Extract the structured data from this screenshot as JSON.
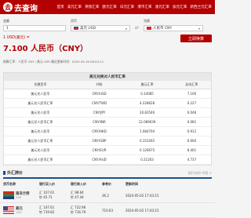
{
  "header": {
    "logo": "去查询",
    "logo_mark": "去",
    "nav": [
      "首页",
      "美元汇率",
      "英镑汇率",
      "欧元汇率",
      "日元汇率",
      "港币汇率",
      "澳元汇率",
      "加元汇率",
      "新西兰元汇率"
    ]
  },
  "form": {
    "amount_label": "金额",
    "amount_value": "1",
    "from_label": "货币",
    "from_value": "美元 USD",
    "to_label": "兑换",
    "to_value": "人民币 CNY",
    "swap_icon": "⇄"
  },
  "result": {
    "small": "1 USD(美元) =",
    "big": "7.100 人民币（CNY）",
    "update": "换算汇率：人民币 CNY / 美元 USD 最近更新时间：2025-05-16 08:02:11",
    "button": "立即换算"
  },
  "table": {
    "title": "美元兑换对人民币汇率",
    "headers": [
      "兑换货币",
      "代码",
      "美元汇率",
      "反向汇率"
    ],
    "rows": [
      [
        "美元兑人民币",
        "CNY/USD",
        "0.14085",
        "7.100"
      ],
      [
        "美元兑人民币汇率",
        "CNY/TWD",
        "4.228628",
        "0.227"
      ],
      [
        "美元兑人民币",
        "CNY/JPY",
        "20.83546",
        "0.048"
      ],
      [
        "美元兑人民币汇率",
        "CNY/INR",
        "12.089039",
        "0.081"
      ],
      [
        "美元兑人民币",
        "CNY/HKD",
        "1.084704",
        "0.912"
      ],
      [
        "美元兑人民币汇率",
        "CNY/GBP",
        "0.153292",
        "6.660"
      ],
      [
        "美元兑人民币",
        "CNY/EUR",
        "0.126675",
        "8.401"
      ],
      [
        "美元兑人民币汇率",
        "CNY/AUD",
        "0.21203",
        "4.737"
      ]
    ]
  },
  "banks": {
    "title": "外汇牌价",
    "right": "银行实时 中国 ☉",
    "headers": [
      "货币名称",
      "银行买入价",
      "银行卖入价",
      "参考价",
      "更新时间"
    ],
    "rows": [
      {
        "name": "南非兰特",
        "code": "ZAR",
        "buy1": "汇 107.61",
        "buy2": "钞 45.71",
        "sell": "汇 98.64",
        "sell2": "钞 47.44",
        "ref": "36.2",
        "time": "2024-05-02 17:43:15"
      },
      {
        "name": "美元",
        "code": "USD",
        "buy1": "汇 107.61",
        "buy2": "钞 719.82",
        "sell": "汇 722.96",
        "sell2": "钞 716.79",
        "ref": "710.63",
        "time": "2024-05-02 17:43:15"
      }
    ]
  },
  "colors": {
    "brand": "#b30000",
    "section_accent": "#1a4f8b"
  }
}
